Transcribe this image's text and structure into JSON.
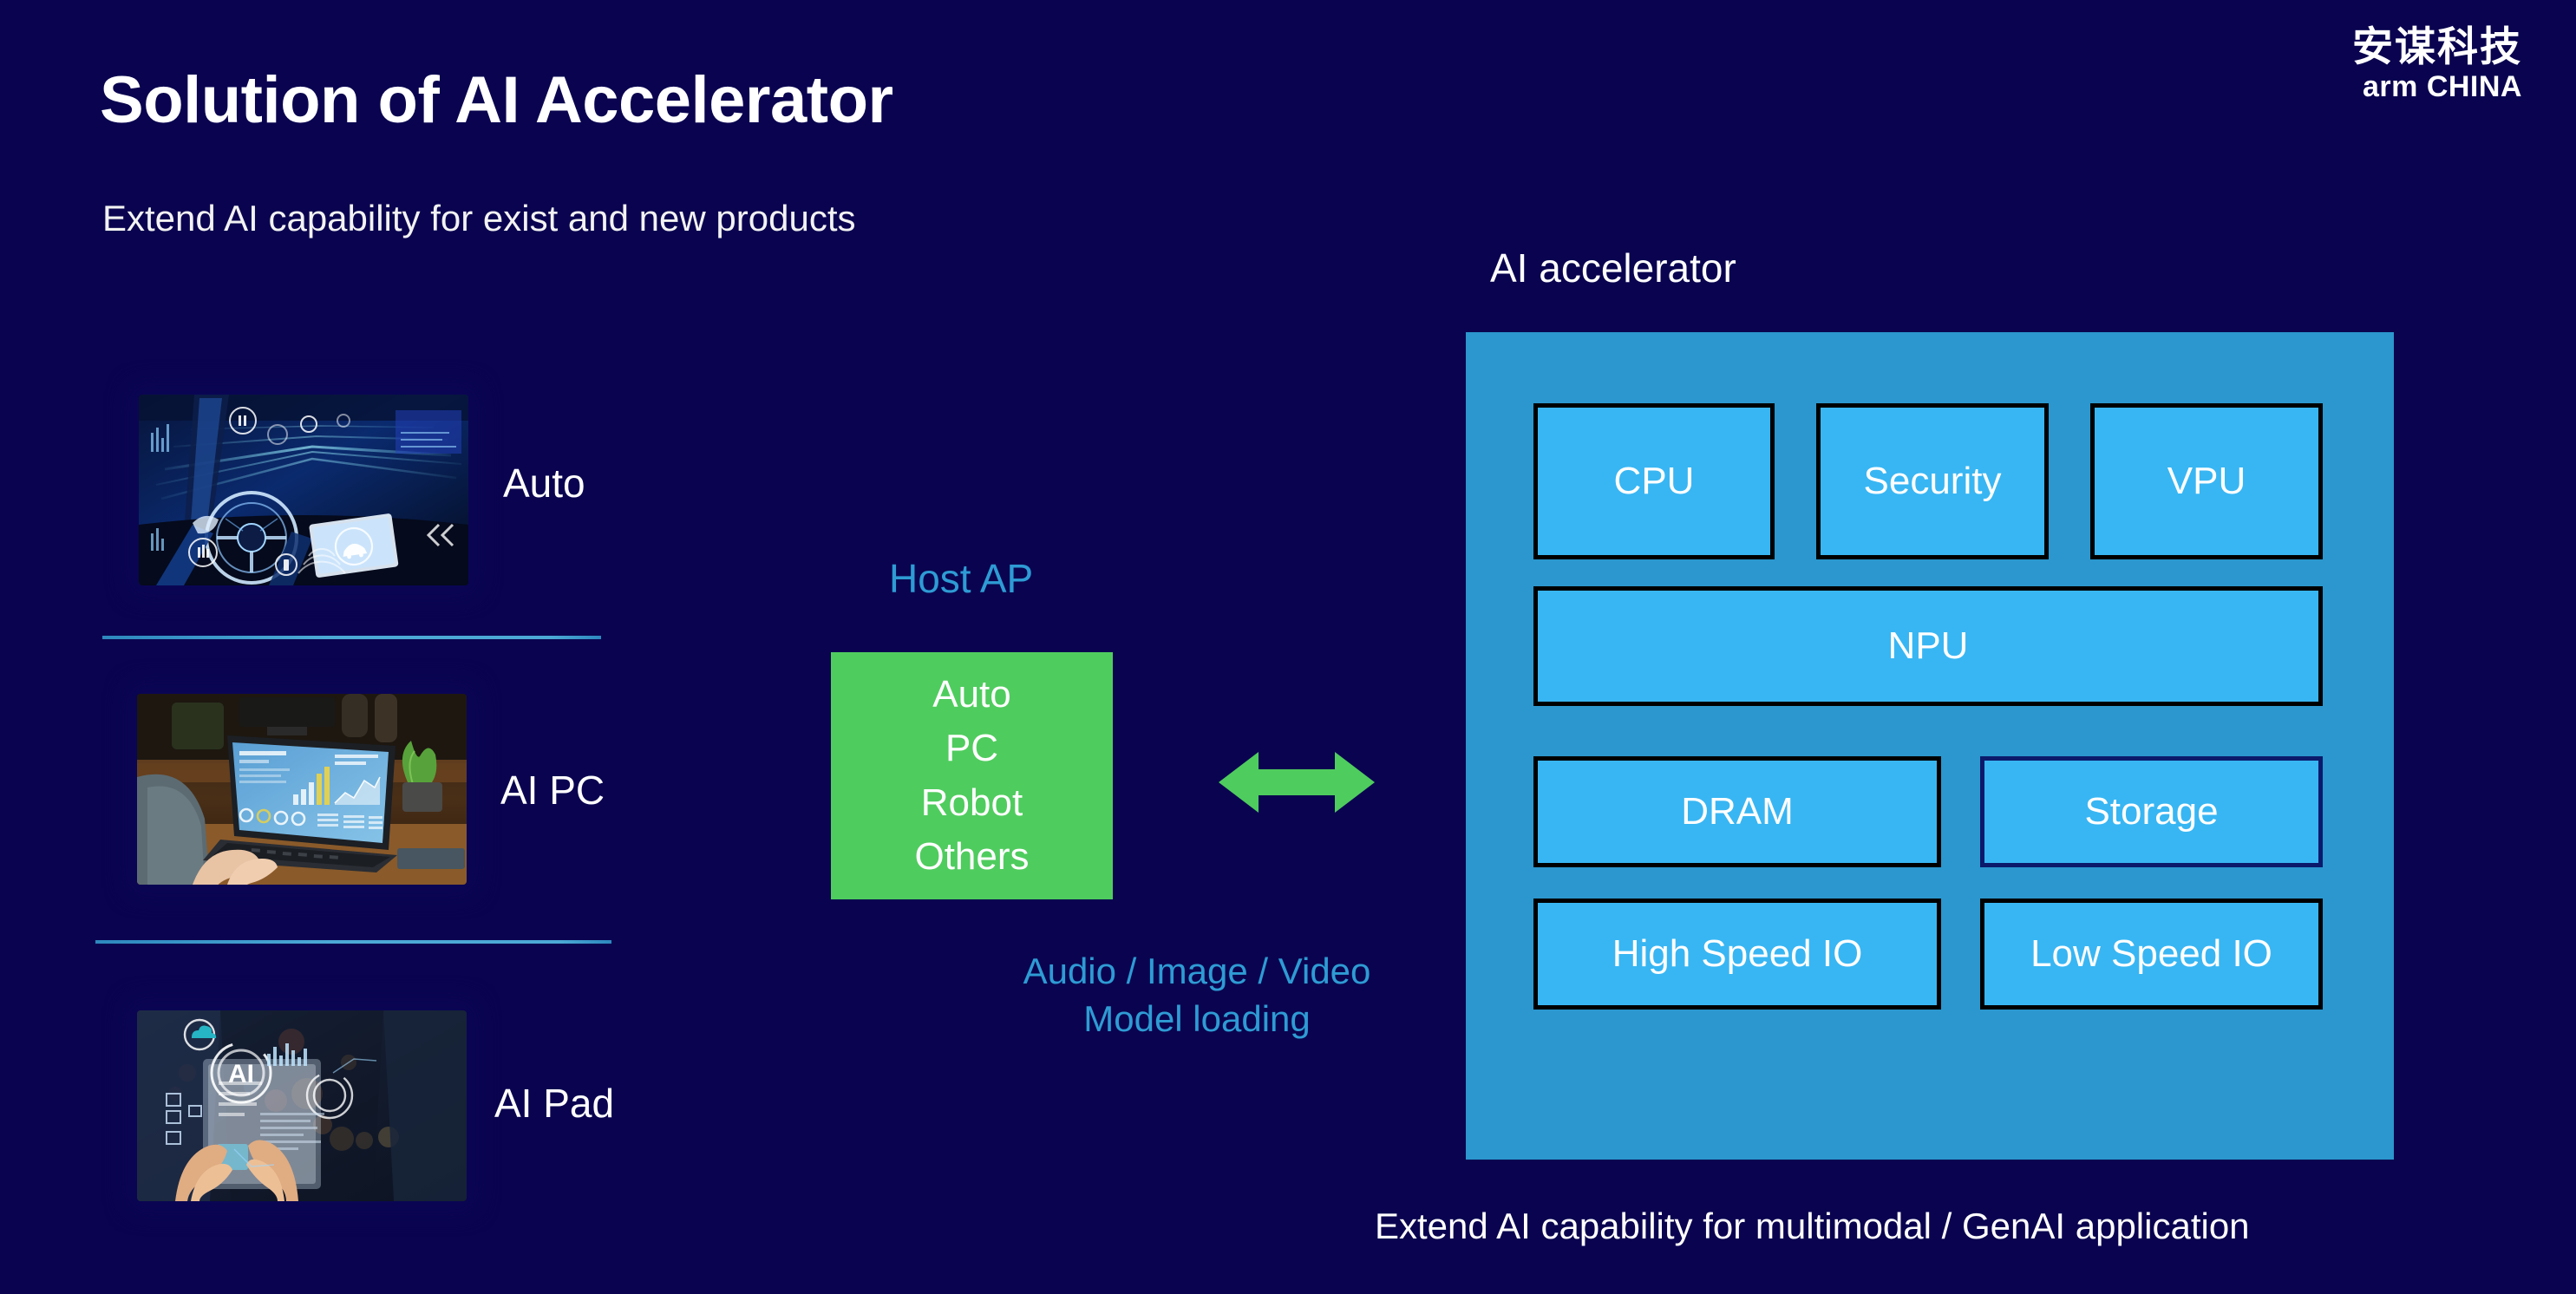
{
  "slide": {
    "title": "Solution of AI Accelerator",
    "subtitle": "Extend AI capability for exist and new products",
    "bottom_caption": "Extend AI capability for multimodal / GenAI application",
    "background_color": "#0a0450"
  },
  "logo": {
    "chinese": "安谋科技",
    "english_brand": "arm",
    "english_region": "CHINA"
  },
  "products": [
    {
      "label": "Auto",
      "image_name": "automotive-cockpit-photo"
    },
    {
      "label": "AI PC",
      "image_name": "laptop-analytics-photo"
    },
    {
      "label": "AI Pad",
      "image_name": "tablet-ai-hologram-photo"
    }
  ],
  "host": {
    "label": "Host AP",
    "label_color": "#2e9bd4",
    "box_color": "#4fcc5e",
    "items": [
      "Auto",
      "PC",
      "Robot",
      "Others"
    ],
    "caption_line1": "Audio / Image / Video",
    "caption_line2": "Model loading",
    "caption_color": "#2e9bd4"
  },
  "arrow": {
    "name": "bidirectional-arrow",
    "color": "#4fcc5e"
  },
  "accelerator": {
    "label": "AI accelerator",
    "container_color": "#2b97ce",
    "block_color": "#38b6f3",
    "blocks": [
      {
        "label": "CPU",
        "border": "#000000"
      },
      {
        "label": "Security",
        "border": "#000000"
      },
      {
        "label": "VPU",
        "border": "#000000"
      },
      {
        "label": "NPU",
        "border": "#000000"
      },
      {
        "label": "DRAM",
        "border": "#000000"
      },
      {
        "label": "Storage",
        "border": "#0b1a6b"
      },
      {
        "label": "High Speed IO",
        "border": "#000000"
      },
      {
        "label": "Low Speed IO",
        "border": "#000000"
      }
    ]
  }
}
